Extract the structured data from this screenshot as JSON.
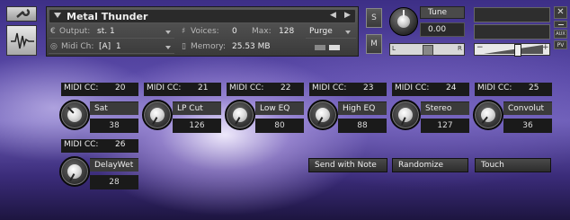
{
  "header": {
    "instrument_name": "Metal Thunder",
    "output_label": "Output:",
    "output_value": "st. 1",
    "voices_label": "Voices:",
    "voices_value": "0",
    "max_label": "Max:",
    "max_value": "128",
    "purge_label": "Purge",
    "midi_ch_label": "Midi Ch:",
    "midi_ch_value": "[A]  1",
    "memory_label": "Memory:",
    "memory_value": "25.53 MB"
  },
  "controls": {
    "solo_label": "S",
    "mute_label": "M",
    "tune_label": "Tune",
    "tune_value": "0.00",
    "pan_left": "L",
    "pan_right": "R",
    "aux_label": "AUX",
    "pv_label": "PV",
    "vol_minus": "−",
    "vol_plus": "+"
  },
  "knobs": [
    {
      "cc_label": "MIDI CC:",
      "cc_value": "20",
      "name": "Sat",
      "value": "38"
    },
    {
      "cc_label": "MIDI CC:",
      "cc_value": "21",
      "name": "LP Cut",
      "value": "126"
    },
    {
      "cc_label": "MIDI CC:",
      "cc_value": "22",
      "name": "Low EQ",
      "value": "80"
    },
    {
      "cc_label": "MIDI CC:",
      "cc_value": "23",
      "name": "High EQ",
      "value": "88"
    },
    {
      "cc_label": "MIDI CC:",
      "cc_value": "24",
      "name": "Stereo",
      "value": "127"
    },
    {
      "cc_label": "MIDI CC:",
      "cc_value": "25",
      "name": "Convolut",
      "value": "36"
    },
    {
      "cc_label": "MIDI CC:",
      "cc_value": "26",
      "name": "DelayWet",
      "value": "28"
    }
  ],
  "buttons": {
    "send_with_note": "Send with Note",
    "randomize": "Randomize",
    "touch": "Touch"
  }
}
